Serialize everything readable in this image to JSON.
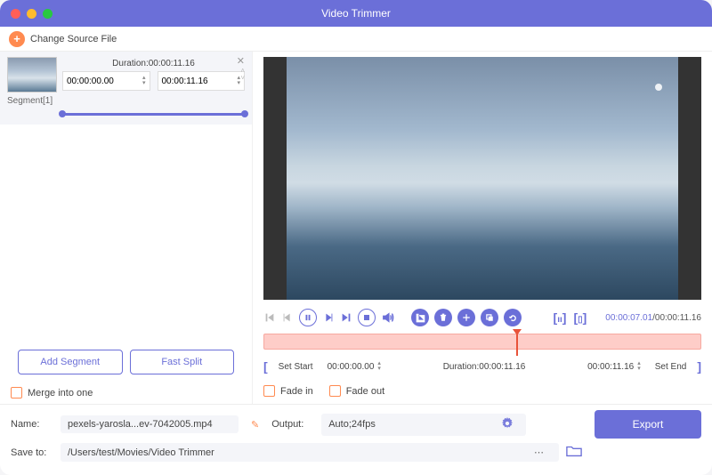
{
  "app": {
    "title": "Video Trimmer",
    "change_source": "Change Source File"
  },
  "segment": {
    "name": "Segment[1]",
    "duration_label": "Duration:",
    "duration_value": "00:00:11.16",
    "start": "00:00:00.00",
    "end": "00:00:11.16"
  },
  "left": {
    "add_segment": "Add Segment",
    "fast_split": "Fast Split",
    "merge": "Merge into one"
  },
  "controls": {
    "time_current": "00:00:07.01",
    "time_total": "/00:00:11.16"
  },
  "range": {
    "set_start": "Set Start",
    "start_val": "00:00:00.00",
    "duration_label": "Duration:",
    "duration_val": "00:00:11.16",
    "end_val": "00:00:11.16",
    "set_end": "Set End"
  },
  "fade": {
    "in": "Fade in",
    "out": "Fade out"
  },
  "bottom": {
    "name_label": "Name:",
    "name_value": "pexels-yarosla...ev-7042005.mp4",
    "output_label": "Output:",
    "output_value": "Auto;24fps",
    "save_label": "Save to:",
    "save_value": "/Users/test/Movies/Video Trimmer",
    "export": "Export"
  }
}
